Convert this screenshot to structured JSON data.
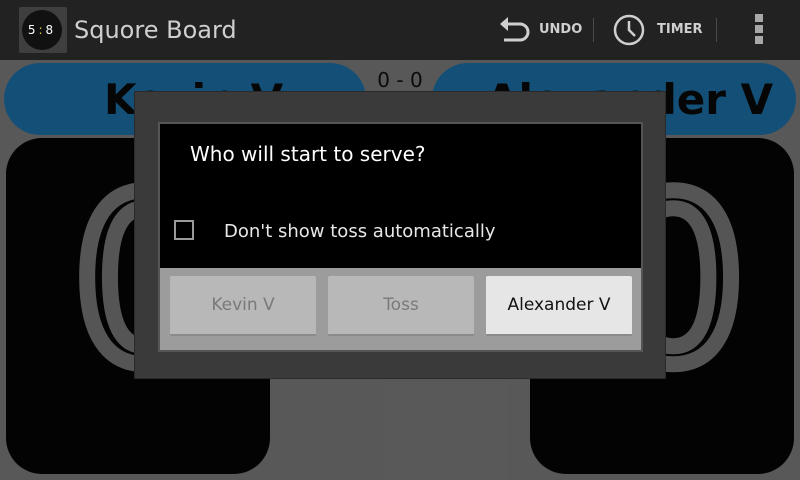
{
  "actionbar": {
    "title": "Squore Board",
    "logo": {
      "left_digit": "5",
      "colon": ":",
      "right_digit": "8"
    },
    "undo_label": "UNDO",
    "timer_label": "TIMER",
    "icons": {
      "undo": "undo-icon",
      "timer": "timer-icon",
      "overflow": "overflow-menu-icon"
    }
  },
  "board": {
    "score": "0 - 0",
    "player_left": {
      "name": "Kevin V",
      "points": "0"
    },
    "player_right": {
      "name": "Alexander V",
      "points": "0"
    },
    "colors": {
      "player_bg": "#1f80bf",
      "panel_bg": "#050505"
    }
  },
  "dialog": {
    "title": "Who will start to serve?",
    "checkbox": {
      "label": "Don't show toss automatically",
      "checked": false
    },
    "buttons": {
      "left": "Kevin V",
      "middle": "Toss",
      "right": "Alexander V"
    }
  }
}
